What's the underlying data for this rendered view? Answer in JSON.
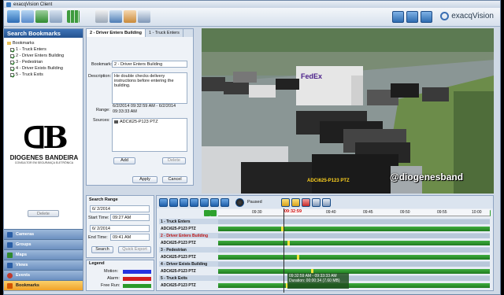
{
  "window": {
    "title": "exacqVision Client"
  },
  "brand": {
    "name": "exacqVision"
  },
  "left": {
    "header": "Search  Bookmarks",
    "root": "Bookmarks",
    "items": [
      "1 - Truck Enters",
      "2 - Driver Enters Building",
      "3 - Pedestrian",
      "4 - Driver Exists Building",
      "5 - Truck Exits"
    ],
    "logo_name": "DIOGENES BANDEIRA",
    "logo_sub": "CONSULTOR EM SEGURANÇA ELETRÔNICA",
    "delete_label": "Delete",
    "nav": [
      {
        "label": "Cameras",
        "color": "#2a5ea6"
      },
      {
        "label": "Groups",
        "color": "#2a5ea6"
      },
      {
        "label": "Maps",
        "color": "#2f8a2f"
      },
      {
        "label": "Views",
        "color": "#2a5ea6"
      },
      {
        "label": "Events",
        "color": "#c0392b"
      },
      {
        "label": "Bookmarks",
        "color": "#d35400"
      }
    ]
  },
  "editor": {
    "tabs": [
      "2 - Driver Enters Building",
      "1 - Truck Enters"
    ],
    "bookmark_label": "Bookmark:",
    "bookmark_value": "2 - Driver Enters Building",
    "description_label": "Description:",
    "description_value": "He double checks delivery instructions before entering the building.",
    "range_label": "Range:",
    "range_value": "6/2/2014 09:32:59 AM - 6/2/2014 09:33:33 AM",
    "sources_label": "Sources:",
    "source": "ADCi625-P123 PTZ",
    "add": "Add",
    "delete": "Delete",
    "apply": "Apply",
    "cancel": "Cancel"
  },
  "video": {
    "camera": "ADCi625-P123 PTZ",
    "watermark": "@diogenesband",
    "truck_text": "FedEx"
  },
  "search": {
    "title": "Search Range",
    "start_date": "6/ 2/2014",
    "start_time_label": "Start Time:",
    "start_time": "09:27 AM",
    "end_date": "6/ 2/2014",
    "end_time_label": "End Time:",
    "end_time": "09:41 AM",
    "search_btn": "Search",
    "quick_export": "Quick Export"
  },
  "legend": {
    "title": "Legend",
    "items": [
      {
        "label": "Motion:",
        "color": "#2433e0"
      },
      {
        "label": "Alarm:",
        "color": "#d21e1e"
      },
      {
        "label": "Free Run:",
        "color": "#2a9a2a"
      }
    ]
  },
  "timeline": {
    "paused": "Paused",
    "ticks": [
      "09:30",
      "09:35",
      "09:40",
      "09:45",
      "09:50",
      "09:55",
      "10:00",
      "10:05"
    ],
    "cursor_time": "09:32:59",
    "rows": [
      {
        "label": "1 - Truck Enters",
        "kind": "hdr"
      },
      {
        "label": "ADCi625-P123 PTZ",
        "kind": "cam"
      },
      {
        "label": "2 - Driver Enters Building",
        "kind": "hdrred"
      },
      {
        "label": "ADCi625-P123 PTZ",
        "kind": "cam"
      },
      {
        "label": "3 - Pedestrian",
        "kind": "hdr"
      },
      {
        "label": "ADCi625-P123 PTZ",
        "kind": "cam"
      },
      {
        "label": "4 - Driver Exists Building",
        "kind": "hdr"
      },
      {
        "label": "ADCi625-P123 PTZ",
        "kind": "cam"
      },
      {
        "label": "5 - Truck Exits",
        "kind": "hdr"
      },
      {
        "label": "ADCi625-P123 PTZ",
        "kind": "cam"
      }
    ],
    "selection_line1": "09:32:59 AM - 09:33:33 AM",
    "selection_line2": "Duration: 00:00:34 (7.60 MB)"
  }
}
